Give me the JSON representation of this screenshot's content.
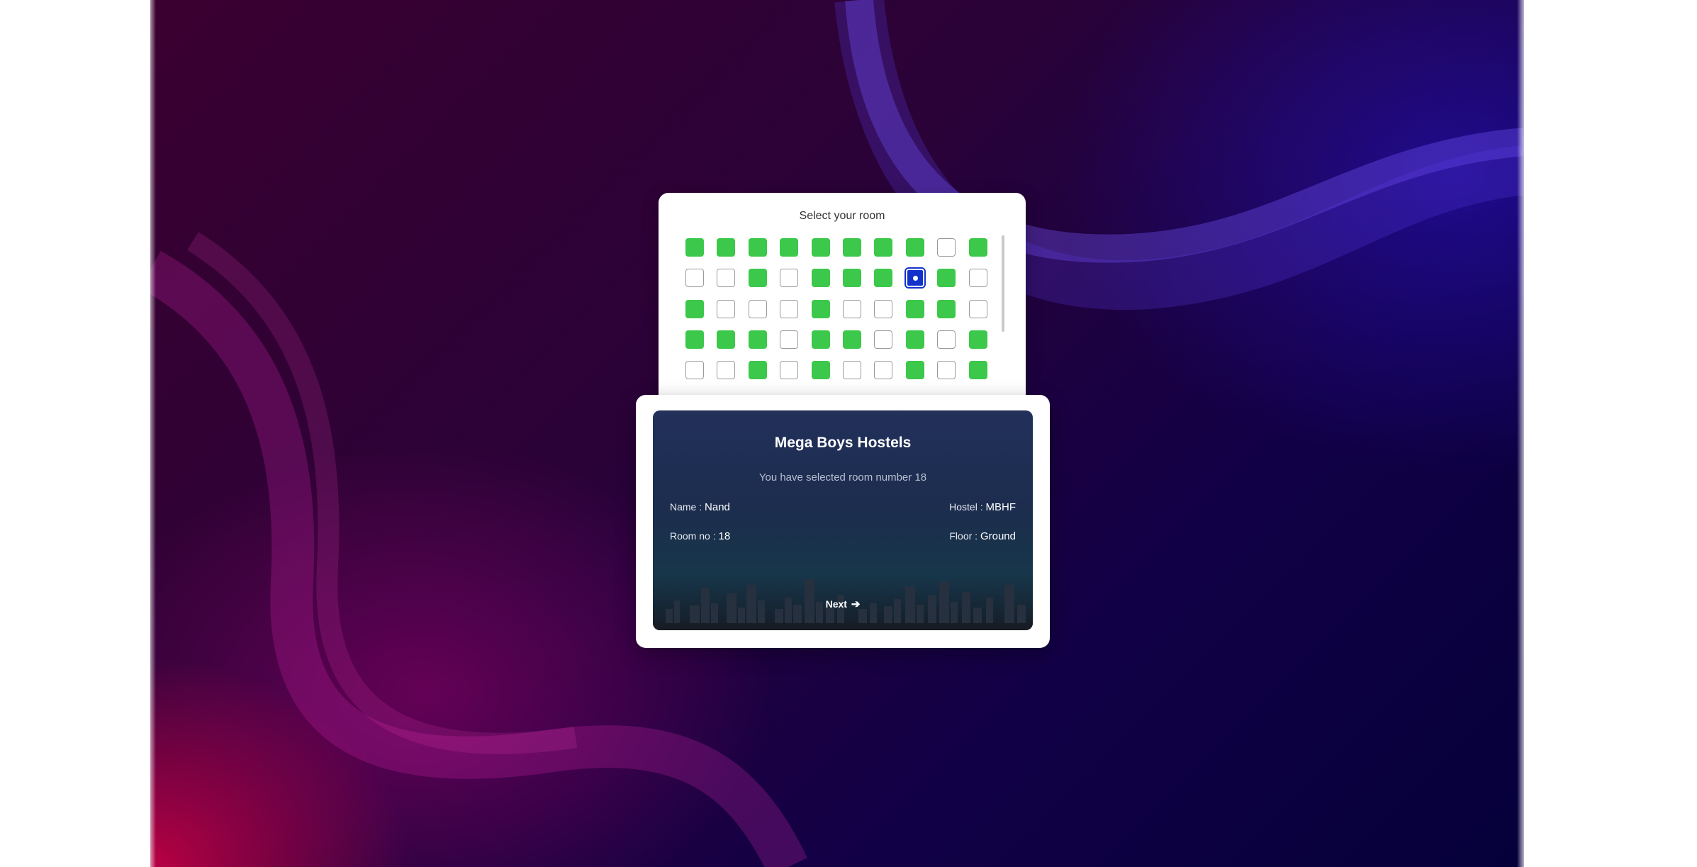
{
  "room_picker": {
    "title": "Select your room",
    "rooms": [
      [
        "available",
        "available",
        "available",
        "available",
        "available",
        "available",
        "available",
        "available",
        "booked",
        "available"
      ],
      [
        "booked",
        "booked",
        "available",
        "booked",
        "available",
        "available",
        "available",
        "selected",
        "available",
        "booked"
      ],
      [
        "available",
        "booked",
        "booked",
        "booked",
        "available",
        "booked",
        "booked",
        "available",
        "available",
        "booked"
      ],
      [
        "available",
        "available",
        "available",
        "booked",
        "available",
        "available",
        "booked",
        "available",
        "booked",
        "available"
      ],
      [
        "booked",
        "booked",
        "available",
        "booked",
        "available",
        "booked",
        "booked",
        "available",
        "booked",
        "available"
      ]
    ],
    "colors": {
      "available": "#3cc84a",
      "booked": "#ffffff",
      "selected": "#1133cc"
    }
  },
  "details": {
    "hostel_title": "Mega Boys Hostels",
    "selected_message": "You have selected room number 18",
    "name_label": "Name :",
    "name_value": "Nand",
    "hostel_label": "Hostel :",
    "hostel_value": "MBHF",
    "room_label": "Room no :",
    "room_value": "18",
    "floor_label": "Floor :",
    "floor_value": "Ground",
    "next_label": "Next",
    "next_icon": "arrow-right-icon"
  }
}
